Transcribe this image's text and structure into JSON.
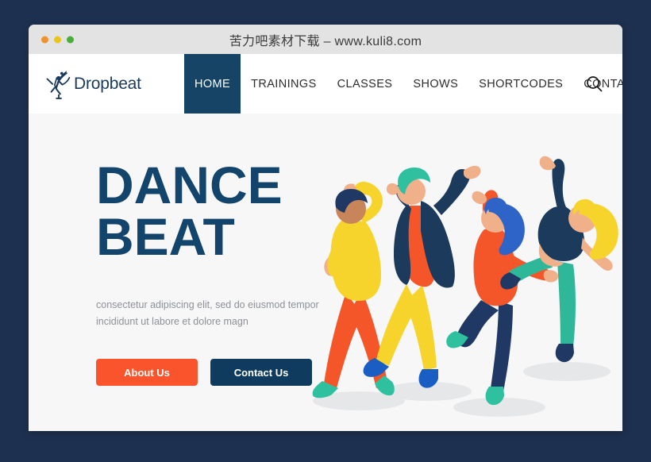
{
  "window": {
    "title": "苦力吧素材下载 – www.kuli8.com",
    "traffic_lights": [
      {
        "name": "close",
        "color": "#f0932b"
      },
      {
        "name": "minimize",
        "color": "#e9c51f"
      },
      {
        "name": "maximize",
        "color": "#4aae3a"
      }
    ]
  },
  "site": {
    "brand": {
      "name": "Dropbeat",
      "icon": "ballerina-icon",
      "color": "#1b3a5c"
    },
    "nav": {
      "items": [
        {
          "label": "HOME",
          "active": true
        },
        {
          "label": "TRAININGS",
          "active": false
        },
        {
          "label": "CLASSES",
          "active": false
        },
        {
          "label": "SHOWS",
          "active": false
        },
        {
          "label": "SHORTCODES",
          "active": false
        },
        {
          "label": "CONTACT",
          "active": false
        }
      ],
      "search_icon": "search-icon",
      "active_bg": "#164467"
    }
  },
  "hero": {
    "title_line1": "DANCE",
    "title_line2": "BEAT",
    "title_color": "#12446c",
    "subtitle_line1": "consectetur adipiscing elit, sed do eiusmod tempor",
    "subtitle_line2": "incididunt ut labore et dolore magn",
    "buttons": [
      {
        "label": "About Us",
        "color": "#f9542c"
      },
      {
        "label": "Contact Us",
        "color": "#0f3c5e"
      }
    ],
    "background": "#f7f7f8",
    "illustration": {
      "name": "four-dancers-illustration",
      "dancers": [
        {
          "id": 1,
          "top": "#f6d42c",
          "bottom": "#f4562a",
          "hair": "#1f3864",
          "shoes": "#2fc0a0"
        },
        {
          "id": 2,
          "top": "#1b3a5c",
          "bottom": "#f6d42c",
          "hair": "#2fc0a0",
          "shoes": "#1a5ec4"
        },
        {
          "id": 3,
          "top": "#f4562a",
          "bottom": "#1f3864",
          "hair": "#2e63c8",
          "shoes": "#2fc0a0"
        },
        {
          "id": 4,
          "top": "#1b3a5c",
          "bottom": "#2fb79a",
          "hair": "#f6d42c",
          "shoes": "#1f3864"
        }
      ]
    }
  },
  "page": {
    "background": "#1e3050"
  }
}
